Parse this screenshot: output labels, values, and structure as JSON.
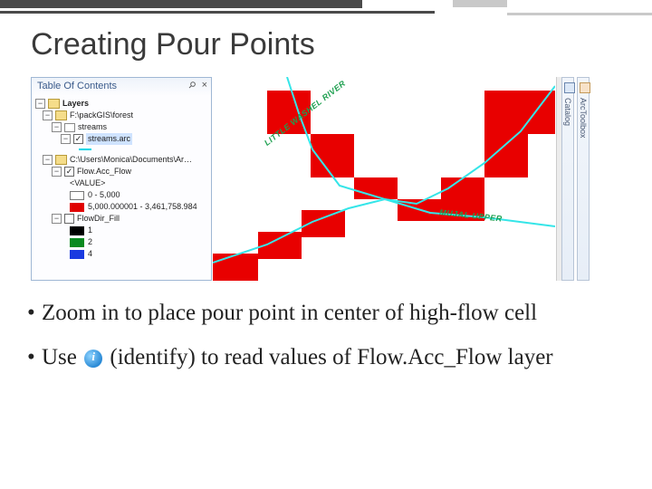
{
  "title": "Creating Pour Points",
  "toc": {
    "panel_title": "Table Of Contents",
    "root": "Layers",
    "grp1_path": "F:\\packGIS\\forest",
    "grp1_layer": "streams",
    "grp1_sub": "streams.arc",
    "grp2_path": "C:\\Users\\Monica\\Documents\\Ar…",
    "flowacc": "Flow.Acc_Flow",
    "value_hdr": "<VALUE>",
    "range1": "0 - 5,000",
    "range2": "5,000.000001 - 3,461,758.984",
    "flowdir": "FlowDir_Fill",
    "v1": "1",
    "v2": "2",
    "v3": "4"
  },
  "map": {
    "label1": "LITTLE WASHEL RIVER",
    "label2": "MUJAL UPPER"
  },
  "dock": {
    "catalog": "Catalog",
    "arctoolbox": "ArcToolbox"
  },
  "bullets": {
    "b1": "Zoom in to place pour point in center of high-flow cell",
    "b2a": "Use ",
    "b2b": " (identify) to read values of Flow.",
    "b2c": "Acc_Flow layer"
  }
}
